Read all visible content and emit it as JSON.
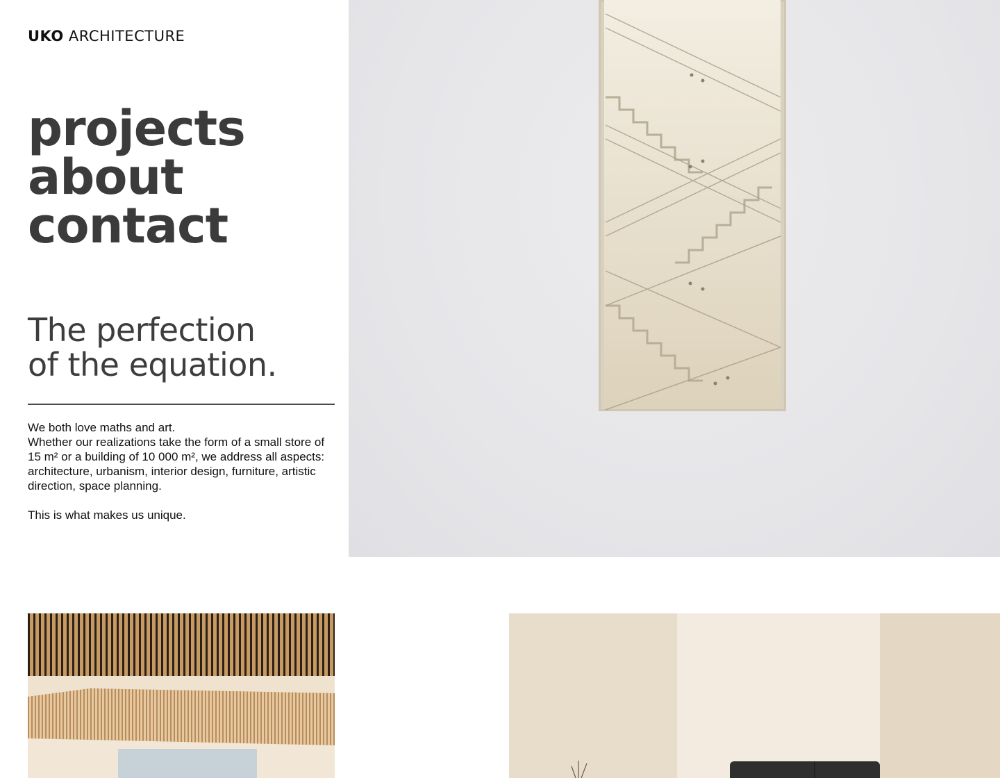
{
  "brand": {
    "name_bold": "UKO",
    "name_light": "ARCHITECTURE"
  },
  "nav": {
    "items": [
      {
        "label": "projects"
      },
      {
        "label": "about"
      },
      {
        "label": "contact"
      }
    ]
  },
  "hero": {
    "tagline_line1": "The perfection",
    "tagline_line2": "of the equation.",
    "image": "staircase-window-photo"
  },
  "intro": {
    "line1": "We both love maths and art.",
    "paragraph": "Whether our realizations take the form of a small store of 15 m² or a building of 10 000 m², we address all aspects: architecture, urbanism, interior design, furniture, artistic direction, space planning.",
    "closing": "This is what makes us unique."
  },
  "gallery": {
    "images": [
      "wooden-ceiling-atrium-photo",
      "sofa-interior-photo"
    ]
  },
  "colors": {
    "text": "#3d3d3d",
    "hero_bg": "#e6e6e9",
    "divider": "#4a4a4a"
  }
}
